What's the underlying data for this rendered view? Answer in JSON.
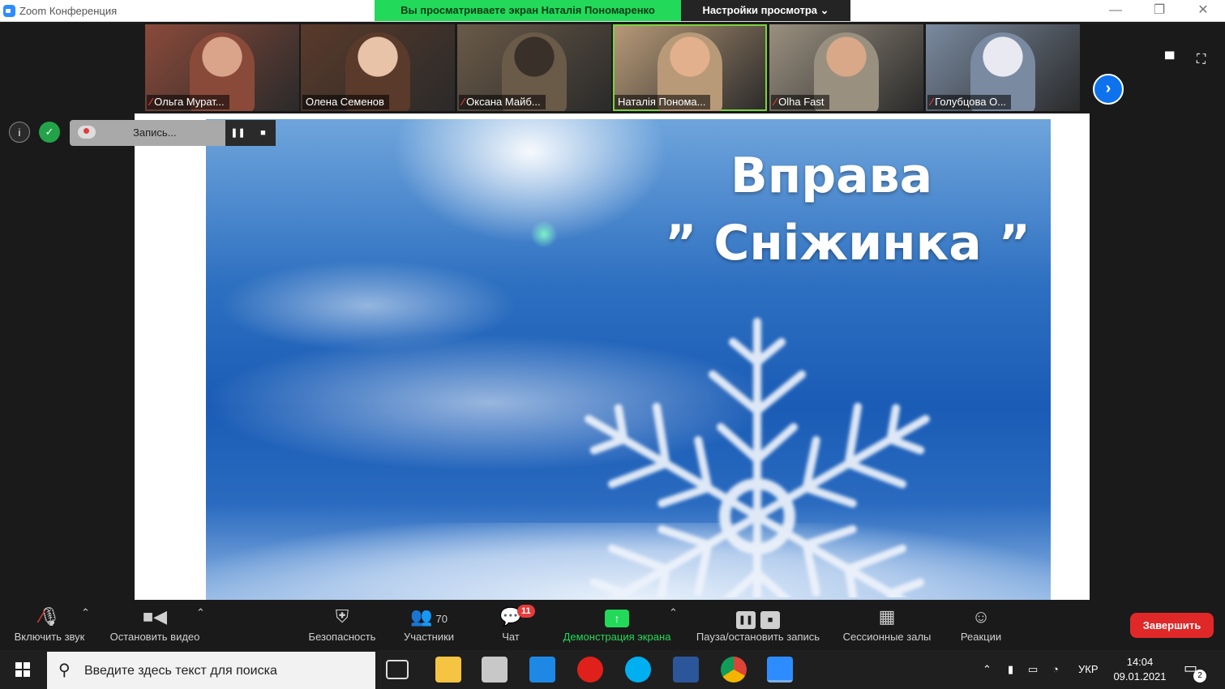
{
  "window": {
    "title": "Zoom Конференция",
    "share_banner": "Вы просматриваете экран Наталія Пономаренко",
    "view_options": "Настройки просмотра",
    "view_options_caret": "⌄",
    "minimize": "—",
    "maximize": "❐",
    "close": "✕"
  },
  "participants": [
    {
      "name": "Ольга Мурат...",
      "muted": true,
      "bg": "#8a4a3a",
      "skin": "#d9a48a"
    },
    {
      "name": "Олена Семенов",
      "muted": false,
      "bg": "#5a3a2a",
      "skin": "#e8c3a8"
    },
    {
      "name": "Оксана Майб...",
      "muted": true,
      "bg": "#6a5a48",
      "skin": "#3a302a"
    },
    {
      "name": "Наталія Понома...",
      "muted": false,
      "bg": "#b89a78",
      "skin": "#e3b08e",
      "active": true
    },
    {
      "name": "Olha Fast",
      "muted": true,
      "bg": "#9a9080",
      "skin": "#d8a888"
    },
    {
      "name": "Голубцова О...",
      "muted": true,
      "bg": "#7a8aa0",
      "skin": "#e9e9f2"
    }
  ],
  "recording": {
    "label": "Запись...",
    "pause_icon": "❚❚",
    "stop_icon": "■"
  },
  "status": {
    "info_icon": "i",
    "shield_icon": "✓"
  },
  "thumb_controls": {
    "next_icon": "›",
    "view_icon": "▀",
    "fullscreen_icon": "⛶"
  },
  "slide": {
    "title": "Вправа",
    "subtitle": "” Сніжинка ”"
  },
  "toolbar": {
    "unmute": "Включить звук",
    "stop_video": "Остановить видео",
    "security": "Безопасность",
    "participants": "Участники",
    "participants_count": "70",
    "chat": "Чат",
    "chat_badge": "11",
    "share": "Демонстрация экрана",
    "pause_record": "Пауза/остановить запись",
    "breakout": "Сессионные залы",
    "reactions": "Реакции",
    "end": "Завершить",
    "caret": "⌃"
  },
  "taskbar": {
    "search_placeholder": "Введите здесь текст для поиска",
    "search_icon": "⚲",
    "language": "УКР",
    "time": "14:04",
    "date": "09.01.2021",
    "notifications": "2",
    "tray_up": "⌃"
  }
}
